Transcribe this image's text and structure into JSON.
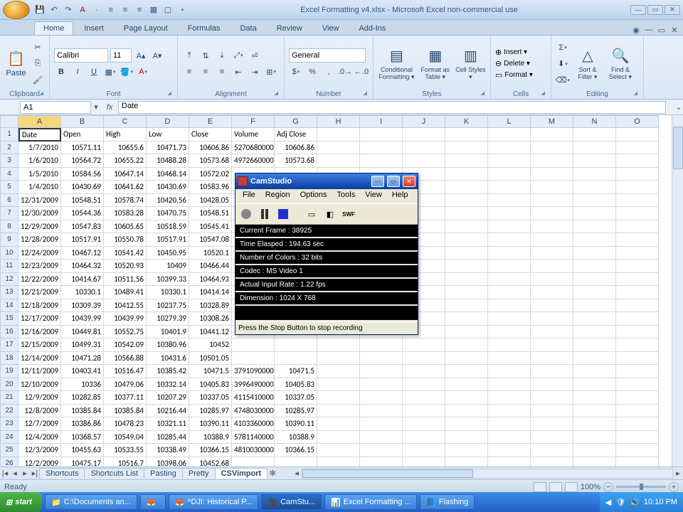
{
  "title": "Excel Formatting v4.xlsx - Microsoft Excel non-commercial use",
  "tabs": [
    "Home",
    "Insert",
    "Page Layout",
    "Formulas",
    "Data",
    "Review",
    "View",
    "Add-Ins"
  ],
  "active_tab": 0,
  "ribbon": {
    "clipboard": {
      "label": "Clipboard",
      "paste": "Paste"
    },
    "font": {
      "label": "Font",
      "name": "Calibri",
      "size": "11"
    },
    "alignment": {
      "label": "Alignment"
    },
    "number": {
      "label": "Number",
      "format": "General"
    },
    "styles": {
      "label": "Styles",
      "cond": "Conditional Formatting ▾",
      "table": "Format as Table ▾",
      "cell": "Cell Styles ▾"
    },
    "cells": {
      "label": "Cells",
      "insert": "Insert ▾",
      "delete": "Delete ▾",
      "format": "Format ▾"
    },
    "editing": {
      "label": "Editing",
      "sort": "Sort & Filter ▾",
      "find": "Find & Select ▾"
    }
  },
  "namebox": "A1",
  "formula": "Date",
  "columns": [
    "A",
    "B",
    "C",
    "D",
    "E",
    "F",
    "G",
    "H",
    "I",
    "J",
    "K",
    "L",
    "M",
    "N",
    "O"
  ],
  "headers": [
    "Date",
    "Open",
    "High",
    "Low",
    "Close",
    "Volume",
    "Adj Close"
  ],
  "rows": [
    [
      "1/7/2010",
      "10571.11",
      "10655.6",
      "10471.73",
      "10606.86",
      "5270680000",
      "10606.86"
    ],
    [
      "1/6/2010",
      "10564.72",
      "10655.22",
      "10488.28",
      "10573.68",
      "4972660000",
      "10573.68"
    ],
    [
      "1/5/2010",
      "10584.56",
      "10647.14",
      "10468.14",
      "10572.02",
      "",
      ""
    ],
    [
      "1/4/2010",
      "10430.69",
      "10641.62",
      "10430.69",
      "10583.96",
      "",
      ""
    ],
    [
      "12/31/2009",
      "10548.51",
      "10578.74",
      "10420.56",
      "10428.05",
      "",
      ""
    ],
    [
      "12/30/2009",
      "10544.36",
      "10583.28",
      "10470.75",
      "10548.51",
      "",
      ""
    ],
    [
      "12/29/2009",
      "10547.83",
      "10605.65",
      "10518.59",
      "10545.41",
      "",
      ""
    ],
    [
      "12/28/2009",
      "10517.91",
      "10550.78",
      "10517.91",
      "10547.08",
      "",
      ""
    ],
    [
      "12/24/2009",
      "10467.12",
      "10541.42",
      "10450.95",
      "10520.1",
      "",
      ""
    ],
    [
      "12/23/2009",
      "10464.32",
      "10520.93",
      "10409",
      "10466.44",
      "",
      ""
    ],
    [
      "12/22/2009",
      "10414.67",
      "10511.56",
      "10399.33",
      "10464.93",
      "",
      ""
    ],
    [
      "12/21/2009",
      "10330.1",
      "10489.41",
      "10330.1",
      "10414.14",
      "",
      ""
    ],
    [
      "12/18/2009",
      "10309.39",
      "10412.55",
      "10237.75",
      "10328.89",
      "",
      ""
    ],
    [
      "12/17/2009",
      "10439.99",
      "10439.99",
      "10279.39",
      "10308.26",
      "",
      ""
    ],
    [
      "12/16/2009",
      "10449.81",
      "10552.75",
      "10401.9",
      "10441.12",
      "",
      ""
    ],
    [
      "12/15/2009",
      "10499.31",
      "10542.09",
      "10380.96",
      "10452",
      "",
      ""
    ],
    [
      "12/14/2009",
      "10471.28",
      "10566.88",
      "10431.6",
      "10501.05",
      "",
      ""
    ],
    [
      "12/11/2009",
      "10403.41",
      "10516.47",
      "10385.42",
      "10471.5",
      "3791090000",
      "10471.5"
    ],
    [
      "12/10/2009",
      "10336",
      "10479.06",
      "10332.14",
      "10405.83",
      "3996490000",
      "10405.83"
    ],
    [
      "12/9/2009",
      "10282.85",
      "10377.11",
      "10207.29",
      "10337.05",
      "4115410000",
      "10337.05"
    ],
    [
      "12/8/2009",
      "10385.84",
      "10385.84",
      "10216.44",
      "10285.97",
      "4748030000",
      "10285.97"
    ],
    [
      "12/7/2009",
      "10386.86",
      "10478.23",
      "10321.11",
      "10390.11",
      "4103360000",
      "10390.11"
    ],
    [
      "12/4/2009",
      "10368.57",
      "10549.04",
      "10285.44",
      "10388.9",
      "5781140000",
      "10388.9"
    ],
    [
      "12/3/2009",
      "10455.63",
      "10533.55",
      "10338.49",
      "10366.15",
      "4810030000",
      "10366.15"
    ],
    [
      "12/2/2009",
      "10475.17",
      "10516.7",
      "10398.06",
      "10452.68",
      "",
      ""
    ]
  ],
  "sheet_tabs": [
    "Shortcuts",
    "Shortcuts List",
    "Pasting",
    "Pretty",
    "CSVimport"
  ],
  "active_sheet": 4,
  "status": "Ready",
  "zoom": "100%",
  "taskbar": {
    "start": "start",
    "items": [
      {
        "icon": "📁",
        "label": "C:\\Documents an..."
      },
      {
        "icon": "🦊",
        "label": ""
      },
      {
        "icon": "🦊",
        "label": "^DJI: Historical P..."
      },
      {
        "icon": "🎥",
        "label": "CamStu..."
      },
      {
        "icon": "📊",
        "label": "Excel Formatting ..."
      },
      {
        "icon": "📘",
        "label": "Flashing"
      }
    ],
    "time": "10:10 PM"
  },
  "camstudio": {
    "title": "CamStudio",
    "menu": [
      "File",
      "Region",
      "Options",
      "Tools",
      "View",
      "Help"
    ],
    "info": [
      "Current Frame : 38925",
      "Time Elasped : 194.63 sec",
      "Number of Colors : 32 bits",
      "Codec : MS Video 1",
      "Actual Input Rate : 1.22 fps",
      "Dimension : 1024 X 768"
    ],
    "status": "Press the Stop Button to stop recording"
  }
}
